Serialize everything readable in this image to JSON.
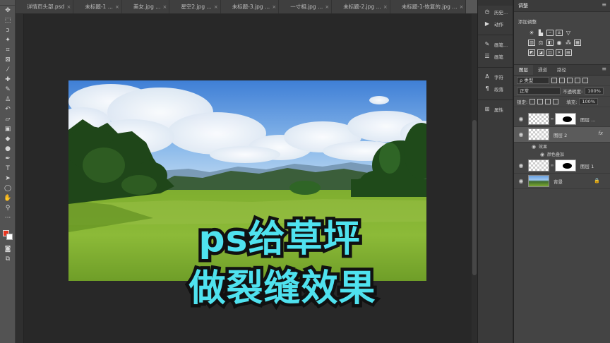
{
  "tabs": [
    {
      "label": "详情页头部.psd",
      "active": false
    },
    {
      "label": "未标题-1 ...",
      "active": false
    },
    {
      "label": "美女.jpg ...",
      "active": false
    },
    {
      "label": "星空2.jpg ...",
      "active": false
    },
    {
      "label": "未标题-3.jpg ...",
      "active": false
    },
    {
      "label": "一寸相.jpg ...",
      "active": false
    },
    {
      "label": "未标题-2.jpg ...",
      "active": false
    },
    {
      "label": "未标题-1-恢复的.jpg ...",
      "active": false
    },
    {
      "label": "草坪.jpg @ 15.3% (图层 2, RGB/8#) *",
      "active": true
    }
  ],
  "tabs_overflow": "»",
  "close_glyph": "×",
  "caption": {
    "line1": "ps给草坪",
    "line2": "做裂缝效果"
  },
  "mid_panel": {
    "items": [
      {
        "icon": "history-icon",
        "glyph": "◷",
        "label": "历史..."
      },
      {
        "icon": "actions-icon",
        "glyph": "▶",
        "label": "动作"
      },
      {
        "icon": "brushes-icon",
        "glyph": "✎",
        "label": "画笔..."
      },
      {
        "icon": "brush-settings-icon",
        "glyph": "☰",
        "label": "画笔"
      },
      {
        "icon": "character-icon",
        "glyph": "A",
        "label": "字符"
      },
      {
        "icon": "paragraph-icon",
        "glyph": "¶",
        "label": "段落"
      },
      {
        "icon": "properties-icon",
        "glyph": "⊞",
        "label": "属性"
      }
    ]
  },
  "adjustments": {
    "title": "调整",
    "add_label": "添加调整",
    "menu_glyph": "≡"
  },
  "layers_panel": {
    "tabs": [
      "图层",
      "通道",
      "路径"
    ],
    "filter_label": "ρ 类型",
    "blend_mode": "正常",
    "opacity_label": "不透明度:",
    "opacity_value": "100%",
    "lock_label": "锁定:",
    "fill_label": "填充:",
    "fill_value": "100%",
    "layers": [
      {
        "name": "图层 ...",
        "type": "masked",
        "active": false
      },
      {
        "name": "图层 2",
        "type": "fx",
        "active": true
      },
      {
        "name": "图层 1",
        "type": "masked",
        "active": false
      },
      {
        "name": "背景",
        "type": "background",
        "active": false
      }
    ],
    "effects_label": "效果",
    "effect_item": "颜色叠加",
    "fx_glyph": "fx",
    "lock_glyph": "🔒",
    "eye_glyph": "◉"
  }
}
